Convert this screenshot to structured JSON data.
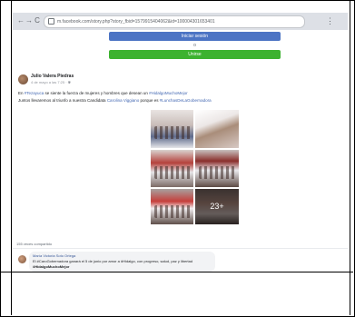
{
  "browser": {
    "back_icon": "←",
    "forward_icon": "→",
    "reload_icon": "C",
    "url": "m.facebook.com/story.php?story_fbid=1579915404062&id=100004301653401",
    "menu_icon": "⋮"
  },
  "login_prompt": {
    "login_label": "Iniciar sesión",
    "or_label": "o",
    "join_label": "Unirse"
  },
  "post": {
    "author": "Julio Valera Piedras",
    "date": "4 de mayo a las 7:25 · ",
    "line1_prefix": "En ",
    "line1_link1": "#Tezayuca",
    "line1_mid": " se siente la fuerza de mujeres y hombres que desean un ",
    "line1_link2": "#HidalgoMuchoMejor",
    "line2_prefix": "Juntos llevaremos al triunfo a nuestra Candidata ",
    "line2_link1": "Carolina Viggiano",
    "line2_mid": " porque es ",
    "line2_link2": "#LunchasDeLaGobernadora",
    "more_photos": "23+",
    "shares": "155 veces compartido"
  },
  "comment": {
    "author": "María Victoria Soto Ortega",
    "line1": "El #CaroGobernadora ganará el 5 de junio por amor a #Hidalgo, con progreso, salud, paz y libertad",
    "line2": "#HidalgoMuchoMejor"
  },
  "colors": {
    "login_button": "#4c74c4",
    "join_button": "#3db230",
    "link": "#4267b2"
  }
}
